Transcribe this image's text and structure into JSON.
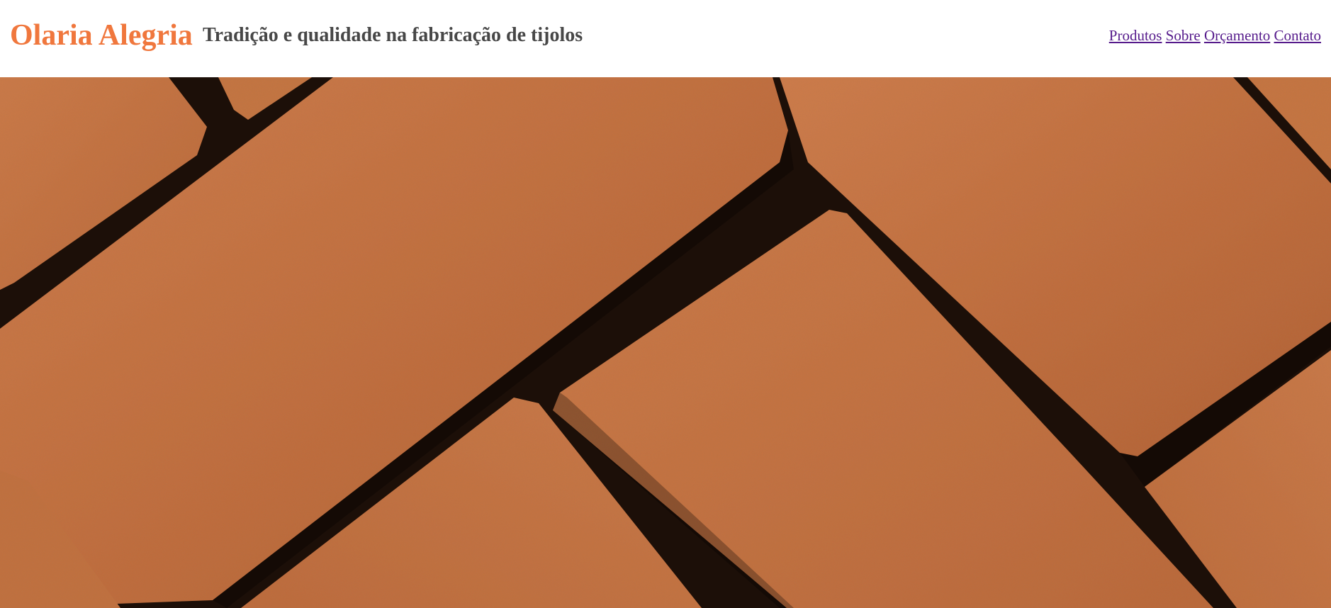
{
  "header": {
    "brand": "Olaria Alegria",
    "tagline": "Tradição e qualidade na fabricação de tijolos",
    "brand_color": "#f0773d",
    "tagline_color": "#474747"
  },
  "nav": {
    "items": [
      {
        "label": "Produtos"
      },
      {
        "label": "Sobre"
      },
      {
        "label": "Orçamento"
      },
      {
        "label": "Contato"
      }
    ],
    "link_color": "#551a8b"
  },
  "hero": {
    "image": "brick-paving-photo",
    "brick_color": "#c97443",
    "gap_color": "#1c0f08"
  }
}
